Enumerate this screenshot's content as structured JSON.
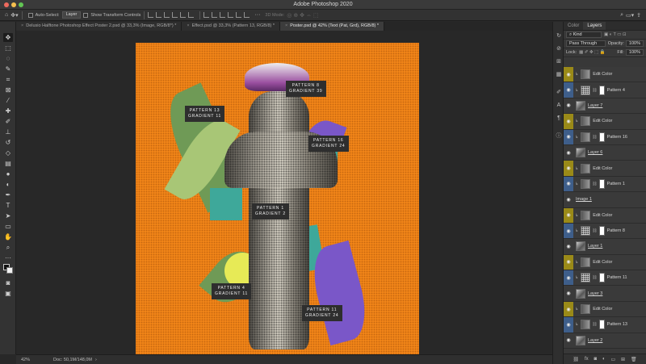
{
  "app": {
    "title": "Adobe Photoshop 2020"
  },
  "options_bar": {
    "auto_select_label": "Auto-Select:",
    "auto_select_target": "Layer",
    "show_transform_label": "Show Transform Controls",
    "mode_3d_label": "3D Mode:"
  },
  "tabs": [
    {
      "label": "Delusio Halftone Photoshop Effect Poster 2.psd @ 33,3% (Image, RGB/8*) *"
    },
    {
      "label": "Effect.psd @ 33,3% (Pattern 13, RGB/8) *"
    },
    {
      "label": "Poster.psd @ 42% (Text (Pat, Grd), RGB/8) *"
    }
  ],
  "canvas_labels": {
    "pattern8": {
      "line1": "PATTERN 8",
      "line2": "GRADIENT 39"
    },
    "pattern13": {
      "line1": "PATTERN 13",
      "line2": "GRADIENT 11"
    },
    "pattern16": {
      "line1": "PATTERN 16",
      "line2": "GRADIENT 24"
    },
    "pattern1": {
      "line1": "PATTERN 1",
      "line2": "GRADIENT 2"
    },
    "pattern4": {
      "line1": "PATTERN 4",
      "line2": "GRADIENT 11"
    },
    "pattern11": {
      "line1": "PATTERN 11",
      "line2": "GRADIENT 24"
    }
  },
  "status": {
    "zoom": "42%",
    "doc": "Doc: 50,1M/148,0M"
  },
  "panel": {
    "tab_color": "Color",
    "tab_layers": "Layers",
    "kind_label": "Kind",
    "blend_mode": "Pass Through",
    "opacity_label": "Opacity:",
    "opacity_value": "100%",
    "lock_label": "Lock:",
    "fill_label": "Fill:",
    "fill_value": "100%"
  },
  "layers": [
    {
      "name": "Edit Color",
      "eye": "y",
      "kind": "adj"
    },
    {
      "name": "Pattern 4",
      "eye": "b",
      "kind": "pat"
    },
    {
      "name": "Layer 7",
      "eye": "",
      "kind": "img"
    },
    {
      "name": "Edit Color",
      "eye": "y",
      "kind": "adj"
    },
    {
      "name": "Pattern 16",
      "eye": "b",
      "kind": "grad"
    },
    {
      "name": "Layer 6",
      "eye": "",
      "kind": "img"
    },
    {
      "name": "Edit Color",
      "eye": "y",
      "kind": "adj"
    },
    {
      "name": "Pattern 1",
      "eye": "b",
      "kind": "grad"
    },
    {
      "name": "Image 1",
      "eye": "",
      "kind": "none"
    },
    {
      "name": "Edit Color",
      "eye": "y",
      "kind": "adj"
    },
    {
      "name": "Pattern 8",
      "eye": "b",
      "kind": "pat"
    },
    {
      "name": "Layer 1",
      "eye": "",
      "kind": "img"
    },
    {
      "name": "Edit Color",
      "eye": "y",
      "kind": "adj"
    },
    {
      "name": "Pattern 11",
      "eye": "b",
      "kind": "pat"
    },
    {
      "name": "Layer 3",
      "eye": "",
      "kind": "img"
    },
    {
      "name": "Edit Color",
      "eye": "y",
      "kind": "adj"
    },
    {
      "name": "Pattern 13",
      "eye": "b",
      "kind": "grad"
    },
    {
      "name": "Layer 2",
      "eye": "",
      "kind": "img"
    }
  ],
  "colors": {
    "canvas_bg": "#f08418",
    "eye_yellow": "#9a8a18",
    "eye_blue": "#3e5e8a"
  }
}
